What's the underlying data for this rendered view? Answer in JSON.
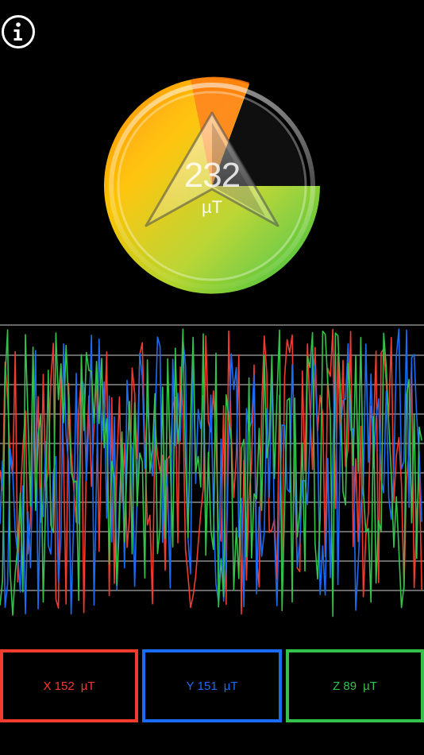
{
  "info_button": {
    "icon": "info-icon"
  },
  "gauge": {
    "value": "232",
    "unit": "µT",
    "colors": {
      "orange": "#ff7a10",
      "yellow": "#ffc400",
      "green": "#33c24a"
    }
  },
  "graph": {
    "series_colors": {
      "x": "#f23b2f",
      "y": "#1a6cf5",
      "z": "#35c24a"
    }
  },
  "axes": [
    {
      "label": "X",
      "value": "152",
      "unit": "µT"
    },
    {
      "label": "Y",
      "value": "151",
      "unit": "µT"
    },
    {
      "label": "Z",
      "value": "89",
      "unit": "µT"
    }
  ]
}
